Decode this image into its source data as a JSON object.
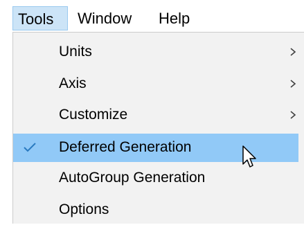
{
  "menubar": {
    "items": [
      {
        "label": "Tools"
      },
      {
        "label": "Window"
      },
      {
        "label": "Help"
      }
    ]
  },
  "dropdown": {
    "items": [
      {
        "label": "Units",
        "submenu": true
      },
      {
        "label": "Axis",
        "submenu": true
      },
      {
        "label": "Customize",
        "submenu": true
      },
      {
        "label": "Deferred Generation",
        "checked": true,
        "highlighted": true
      },
      {
        "label": "AutoGroup Generation"
      },
      {
        "label": "Options"
      }
    ]
  },
  "colors": {
    "active_menubar_bg": "#cce4f7",
    "highlight_bg": "#91c9f7",
    "dropdown_bg": "#f2f2f2",
    "check_color": "#2a7ac0"
  },
  "icons": {
    "submenu": "chevron-right-icon",
    "check": "checkmark-icon",
    "cursor": "mouse-pointer-icon"
  }
}
